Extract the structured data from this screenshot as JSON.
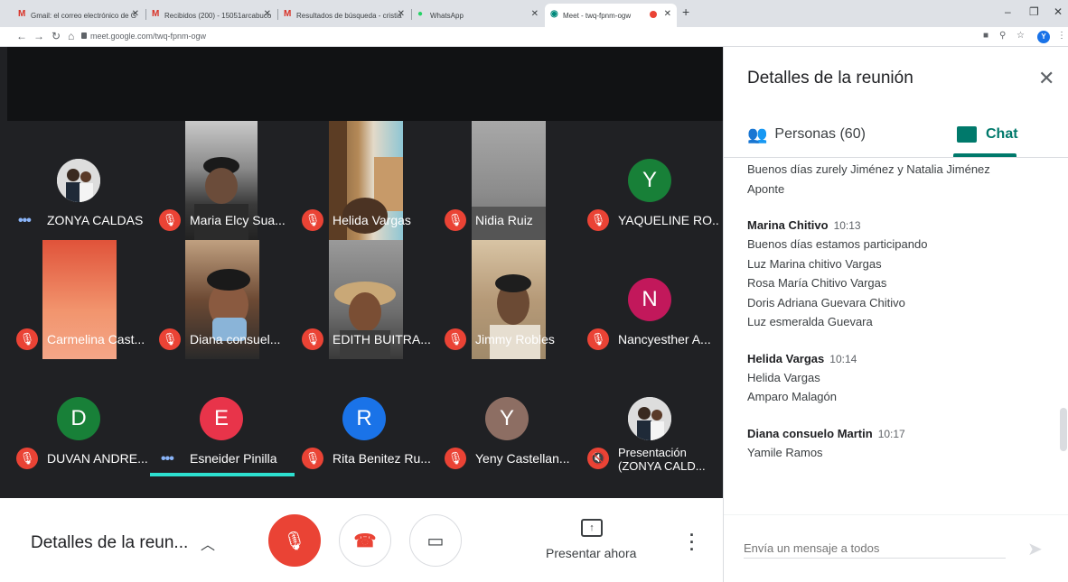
{
  "browser": {
    "tabs": [
      {
        "label": "Gmail: el correo electrónico de G",
        "icon": "gmail-icon"
      },
      {
        "label": "Recibidos (200) - 15051arcabuco",
        "icon": "gmail-icon"
      },
      {
        "label": "Resultados de búsqueda - cristia",
        "icon": "gmail-icon"
      },
      {
        "label": "WhatsApp",
        "icon": "whatsapp-icon"
      },
      {
        "label": "Meet - twq-fpnm-ogw",
        "icon": "meet-icon"
      }
    ],
    "url": "meet.google.com/twq-fpnm-ogw",
    "profile_initial": "Y"
  },
  "participants": [
    {
      "name": "ZONYA CALDAS",
      "mic": "speaking",
      "type": "avatar-photo"
    },
    {
      "name": "Maria Elcy Sua...",
      "mic": "muted",
      "type": "video"
    },
    {
      "name": "Helida Vargas",
      "mic": "muted",
      "type": "video"
    },
    {
      "name": "Nidia Ruiz",
      "mic": "muted",
      "type": "video"
    },
    {
      "name": "YAQUELINE RO...",
      "mic": "muted",
      "initial": "Y",
      "color": "#188038"
    },
    {
      "name": "Carmelina Cast...",
      "mic": "muted",
      "type": "video"
    },
    {
      "name": "Diana consuel...",
      "mic": "muted",
      "type": "video"
    },
    {
      "name": "EDITH BUITRA...",
      "mic": "muted",
      "type": "video"
    },
    {
      "name": "Jimmy Robles",
      "mic": "muted",
      "type": "video"
    },
    {
      "name": "Nancyesther A...",
      "mic": "muted",
      "initial": "N",
      "color": "#c2185b"
    },
    {
      "name": "DUVAN ANDRE...",
      "mic": "muted",
      "initial": "D",
      "color": "#188038"
    },
    {
      "name": "Esneider Pinilla",
      "mic": "speaking",
      "initial": "E",
      "color": "#e8344a"
    },
    {
      "name": "Rita Benitez Ru...",
      "mic": "muted",
      "initial": "R",
      "color": "#1a73e8"
    },
    {
      "name": "Yeny Castellan...",
      "mic": "muted",
      "initial": "Y",
      "color": "#8d6e63"
    },
    {
      "name": "Presentación\n(ZONYA CALD...",
      "mic": "muted",
      "type": "avatar-photo"
    }
  ],
  "bottombar": {
    "title": "Detalles de la reun...",
    "present_label": "Presentar ahora"
  },
  "panel": {
    "title": "Detalles de la reunión",
    "people_tab": "Personas (60)",
    "chat_tab": "Chat",
    "messages": [
      {
        "sender": "",
        "time": "",
        "lines": [
          "Buenos días zurely Jiménez y Natalia Jiménez",
          "Aponte"
        ]
      },
      {
        "sender": "Marina Chitivo",
        "time": "10:13",
        "lines": [
          "Buenos días estamos participando",
          "Luz Marina chitivo Vargas",
          "Rosa María Chitivo Vargas",
          "Doris Adriana Guevara Chitivo",
          "Luz esmeralda Guevara"
        ]
      },
      {
        "sender": "Helida Vargas",
        "time": "10:14",
        "lines": [
          "Helida Vargas",
          "Amparo Malagón"
        ]
      },
      {
        "sender": "Diana consuelo Martin",
        "time": "10:17",
        "lines": [
          "Yamile Ramos"
        ]
      }
    ],
    "compose_placeholder": "Envía un mensaje a todos"
  }
}
